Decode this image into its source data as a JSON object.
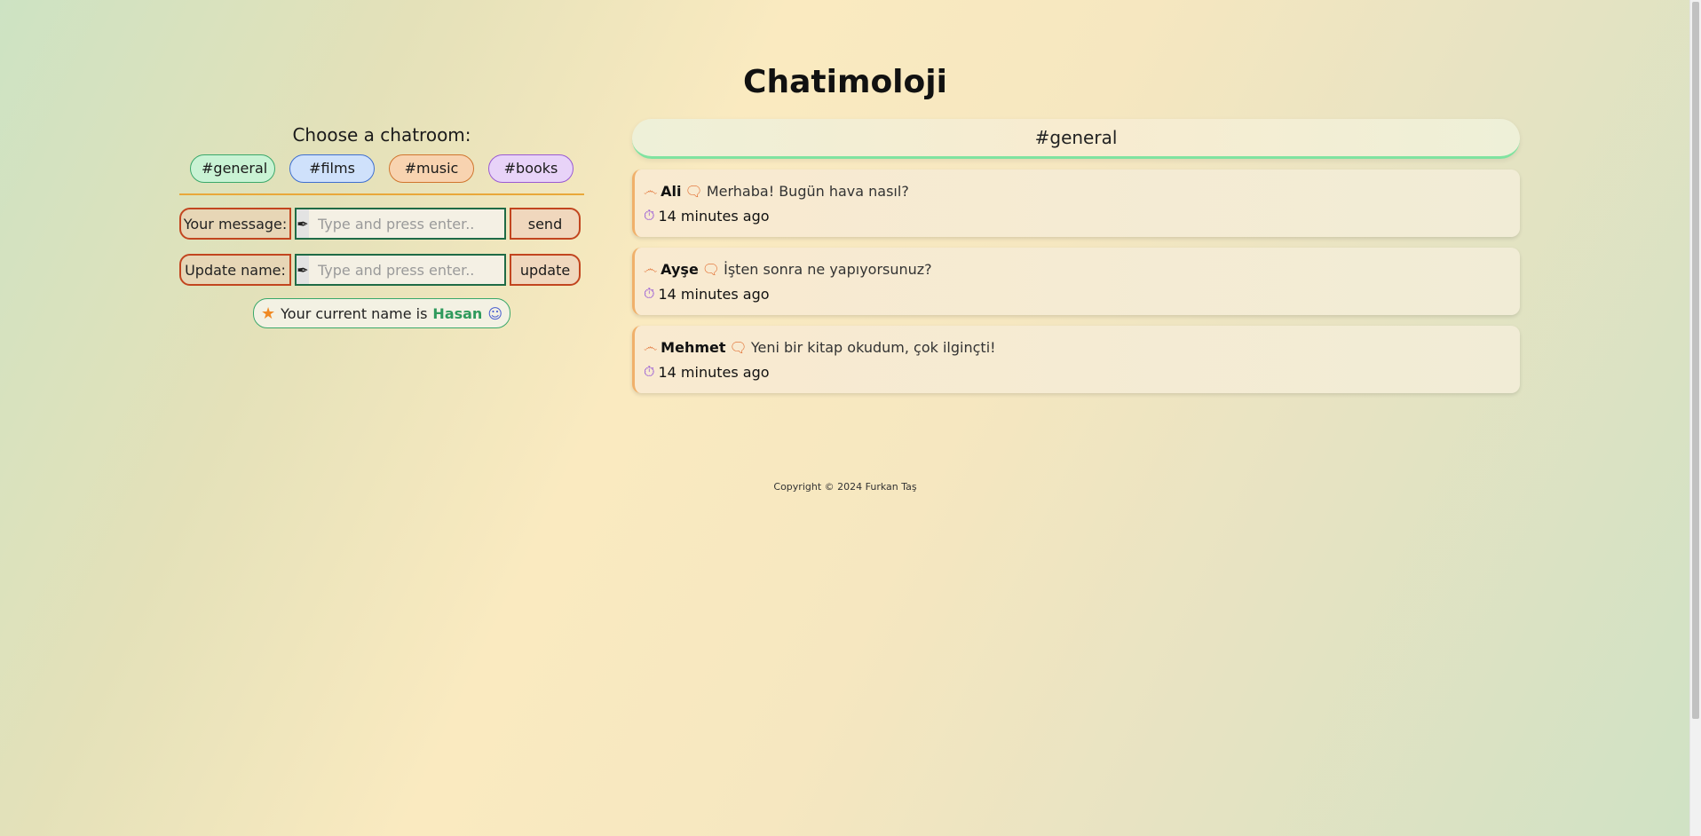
{
  "app": {
    "title": "Chatimoloji"
  },
  "sidebar": {
    "choose_label": "Choose a chatroom:",
    "rooms": [
      {
        "label": "#general"
      },
      {
        "label": "#films"
      },
      {
        "label": "#music"
      },
      {
        "label": "#books"
      }
    ]
  },
  "message_form": {
    "label": "Your message:",
    "placeholder": "Type and press enter..",
    "value": "",
    "button_label": "send"
  },
  "name_form": {
    "label": "Update name:",
    "placeholder": "Type and press enter..",
    "value": "",
    "button_label": "update"
  },
  "current_name": {
    "prefix": "Your current name is",
    "name": "Hasan"
  },
  "chat": {
    "room_title": "#general",
    "messages": [
      {
        "user": "Ali",
        "text": "Merhaba! Bugün hava nasıl?",
        "time": "14 minutes ago"
      },
      {
        "user": "Ayşe",
        "text": "İşten sonra ne yapıyorsunuz?",
        "time": "14 minutes ago"
      },
      {
        "user": "Mehmet",
        "text": "Yeni bir kitap okudum, çok ilginçti!",
        "time": "14 minutes ago"
      }
    ]
  },
  "footer": {
    "copyright": "Copyright © 2024 Furkan Taş"
  },
  "icons": {
    "input_icon": "feather-pen-icon",
    "name_icon": "star-icon",
    "smile_icon": "smile-icon",
    "user_icon": "fingerprint-icon",
    "message_icon": "chat-bubbles-icon",
    "time_icon": "stopwatch-icon"
  },
  "colors": {
    "general": "#c9f3d4",
    "films": "#cfe1fb",
    "music": "#f8d3b0",
    "books": "#e8d3f8",
    "accent": "#c2451f",
    "name_highlight": "#2f9a5c"
  }
}
